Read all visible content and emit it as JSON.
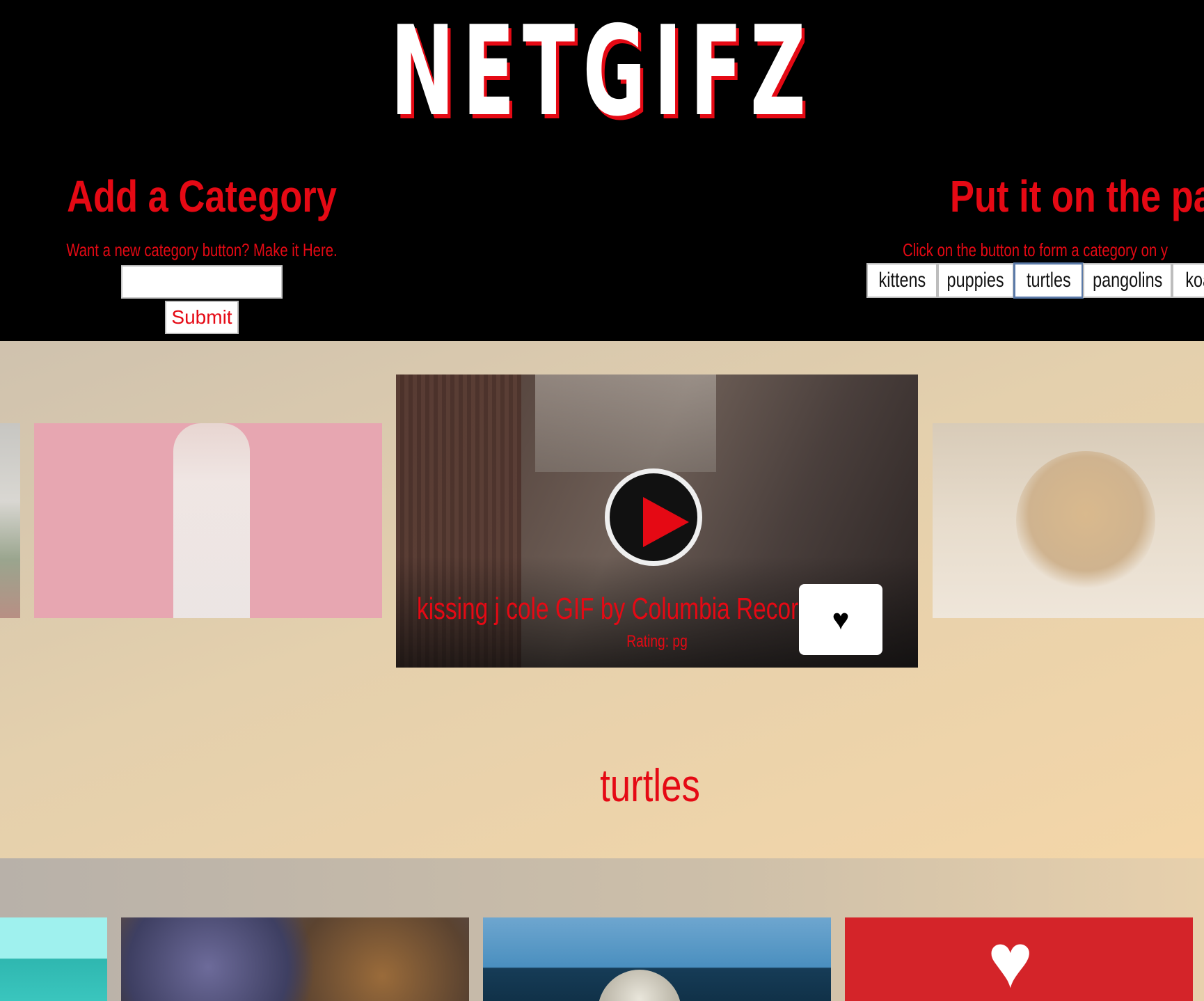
{
  "header": {
    "logo": "NETGIFZ"
  },
  "add_category": {
    "title": "Add a Category",
    "hint": "Want a new category button? Make it Here.",
    "input_value": "",
    "submit_label": "Submit"
  },
  "put_on_page": {
    "title": "Put it on the pag",
    "hint": "Click on the button to form a category on y",
    "buttons": [
      "kittens",
      "puppies",
      "turtles",
      "pangolins",
      "koa"
    ],
    "active": "turtles"
  },
  "featured": {
    "title": "kissing j cole GIF by Columbia Recor",
    "rating": "Rating: pg",
    "favorite_icon": "heart-icon",
    "play_icon": "play-icon"
  },
  "category_heading": "turtles",
  "colors": {
    "accent": "#e50914",
    "header_bg": "#000000"
  }
}
